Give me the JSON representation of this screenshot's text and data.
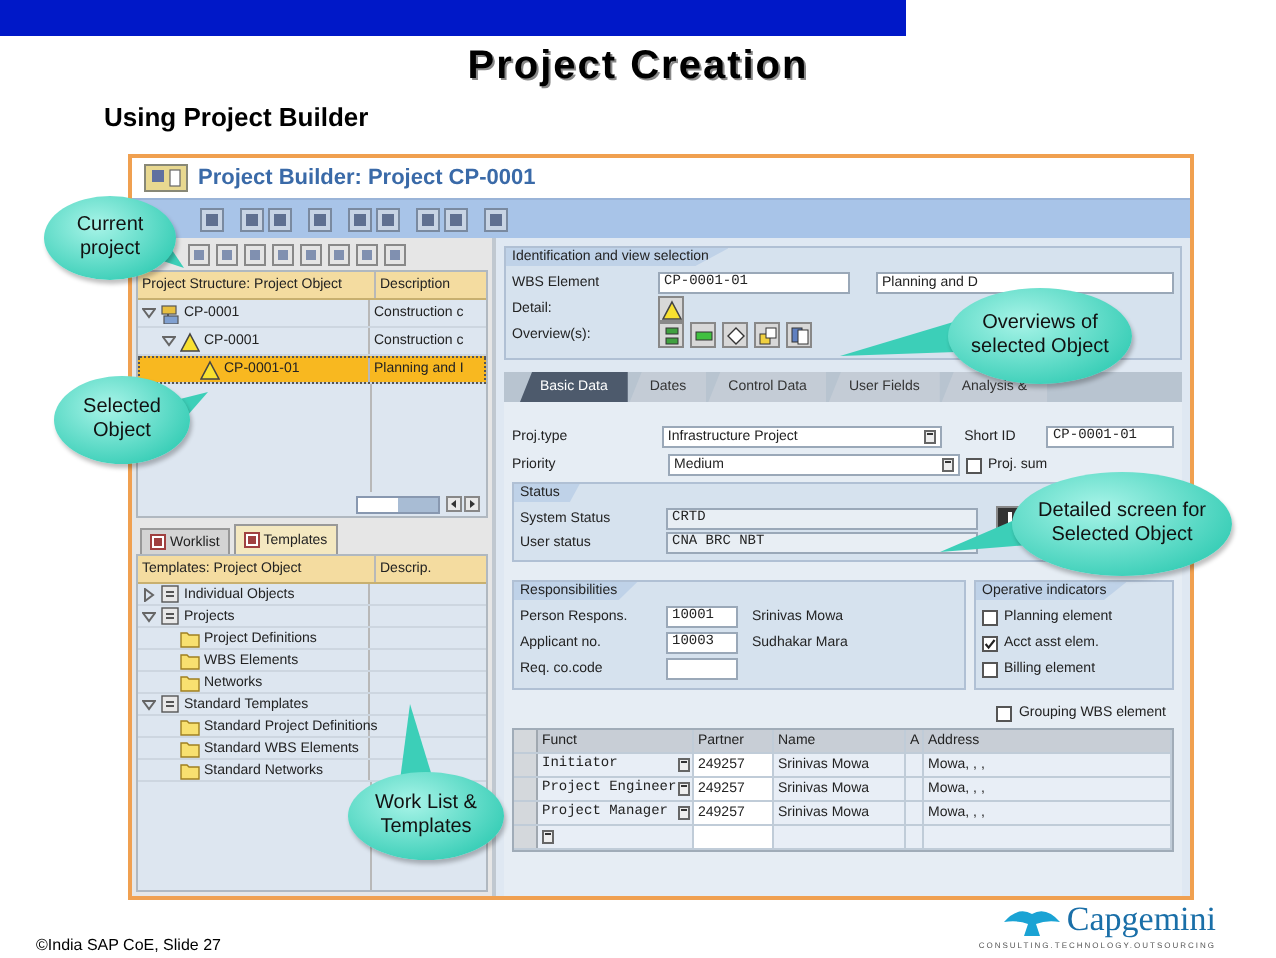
{
  "slide": {
    "title": "Project Creation",
    "subtitle": "Using Project Builder",
    "footer": "©India SAP CoE, Slide 27"
  },
  "logo": {
    "name": "Capgemini",
    "tagline": "CONSULTING.TECHNOLOGY.OUTSOURCING"
  },
  "window": {
    "title": "Project Builder: Project CP-0001"
  },
  "structure": {
    "columns": [
      "Project Structure: Project Object",
      "Description"
    ],
    "rows": [
      {
        "label": "CP-0001",
        "description": "Construction c",
        "kind": "project",
        "expanded": true,
        "selected": false,
        "children": [
          {
            "label": "CP-0001",
            "description": "Construction c",
            "kind": "wbs",
            "expanded": true,
            "selected": false,
            "children": [
              {
                "label": "CP-0001-01",
                "description": "Planning and I",
                "kind": "wbs",
                "selected": true
              }
            ]
          }
        ]
      }
    ]
  },
  "panel_tabs": [
    {
      "label": "Worklist",
      "selected": false
    },
    {
      "label": "Templates",
      "selected": true
    }
  ],
  "templates": {
    "columns": [
      "Templates: Project Object",
      "Descrip."
    ],
    "rows": [
      {
        "label": "Individual Objects",
        "kind": "group",
        "expanded": false
      },
      {
        "label": "Projects",
        "kind": "group",
        "expanded": true,
        "children": [
          {
            "label": "Project Definitions",
            "kind": "folder"
          },
          {
            "label": "WBS Elements",
            "kind": "folder"
          },
          {
            "label": "Networks",
            "kind": "folder"
          }
        ]
      },
      {
        "label": "Standard Templates",
        "kind": "group",
        "expanded": true,
        "children": [
          {
            "label": "Standard Project Definitions",
            "kind": "folder"
          },
          {
            "label": "Standard WBS Elements",
            "kind": "folder"
          },
          {
            "label": "Standard Networks",
            "kind": "folder"
          }
        ]
      }
    ]
  },
  "identification": {
    "title": "Identification and view selection",
    "wbs_label": "WBS Element",
    "wbs_value": "CP-0001-01",
    "description_value": "Planning and D",
    "detail_label": "Detail:",
    "overview_label": "Overview(s):"
  },
  "tabs": [
    {
      "label": "Basic Data",
      "selected": true
    },
    {
      "label": "Dates",
      "selected": false
    },
    {
      "label": "Control Data",
      "selected": false
    },
    {
      "label": "User Fields",
      "selected": false
    },
    {
      "label": "Analysis &",
      "selected": false
    }
  ],
  "basic": {
    "fields": [
      {
        "label": "Proj.type",
        "value": "Infrastructure Project"
      },
      {
        "label": "Priority",
        "value": "Medium"
      }
    ],
    "short_id_label": "Short ID",
    "short_id_value": "CP-0001-01",
    "summary_label": "Proj. sum",
    "summary_checked": false
  },
  "status": {
    "title": "Status",
    "rows": [
      {
        "label": "System Status",
        "value": "CRTD"
      },
      {
        "label": "User status",
        "value": "CNA   BRC   NBT"
      }
    ]
  },
  "responsibilities": {
    "title": "Responsibilities",
    "rows": [
      {
        "label": "Person Respons.",
        "value": "10001",
        "text": "Srinivas Mowa"
      },
      {
        "label": "Applicant no.",
        "value": "10003",
        "text": "Sudhakar Mara"
      },
      {
        "label": "Req. co.code"
      }
    ]
  },
  "operative": {
    "title": "Operative indicators",
    "items": [
      {
        "label": "Planning element",
        "checked": false
      },
      {
        "label": "Acct asst elem.",
        "checked": true
      },
      {
        "label": "Billing element",
        "checked": false
      }
    ]
  },
  "grouping": {
    "label": "Grouping WBS element",
    "checked": false
  },
  "partners": {
    "columns": [
      "Funct",
      "Partner",
      "Name",
      "A",
      "Address"
    ],
    "rows": [
      {
        "funct": "Initiator",
        "partner": "249257",
        "name": "Srinivas Mowa",
        "address": "Mowa, , ,"
      },
      {
        "funct": "Project Engineer",
        "partner": "249257",
        "name": "Srinivas Mowa",
        "address": "Mowa, , ,"
      },
      {
        "funct": "Project Manager",
        "partner": "249257",
        "name": "Srinivas Mowa",
        "address": "Mowa, , ,"
      }
    ]
  },
  "callouts": [
    {
      "text": "Current\nproject"
    },
    {
      "text": "Selected\nObject"
    },
    {
      "text": "Overviews of\nselected Object"
    },
    {
      "text": "Detailed screen for\nSelected Object"
    },
    {
      "text": "Work List  &\nTemplates"
    }
  ]
}
